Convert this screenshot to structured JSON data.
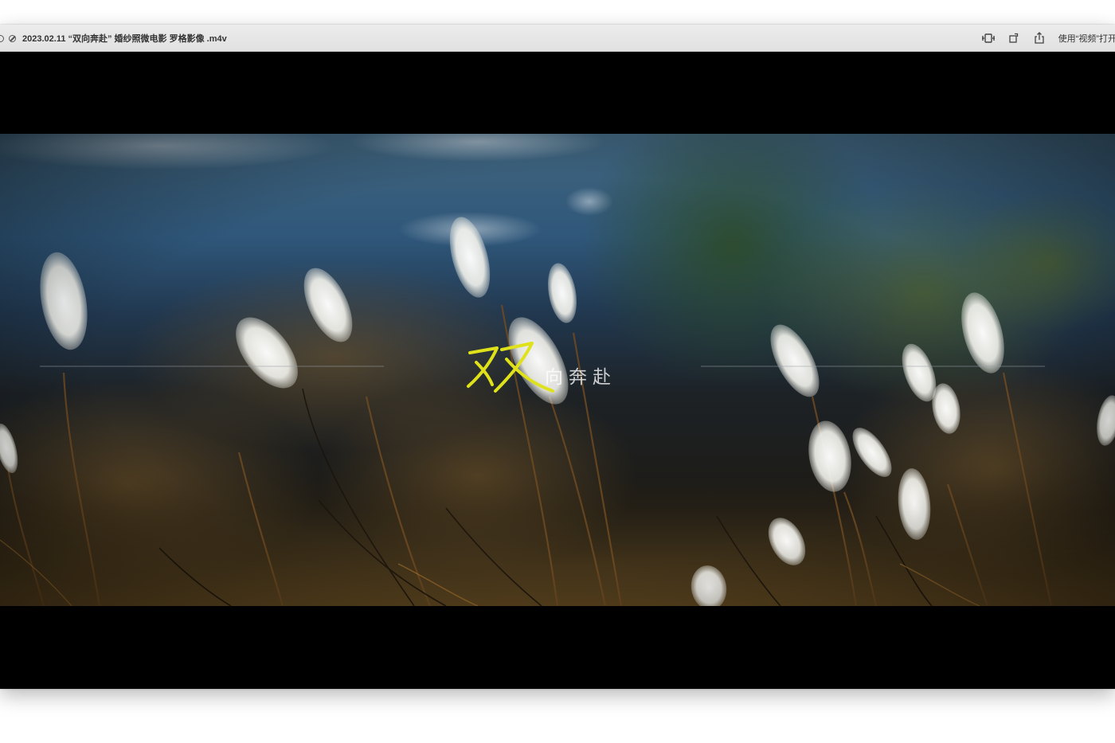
{
  "window": {
    "title": "2023.02.11 “双向奔赴” 婚纱照微电影  罗格影像  .m4v",
    "open_with_label": "使用“视频”打开"
  },
  "toolbar": {
    "icons": [
      "circle-icon",
      "disabled-icon",
      "trim-icon",
      "rotate-icon",
      "share-icon"
    ]
  },
  "video": {
    "title_text": "向奔赴",
    "title_glyph": "双",
    "title_glyph_color": "#dfe21a",
    "line_color": "#9aa0a6"
  }
}
